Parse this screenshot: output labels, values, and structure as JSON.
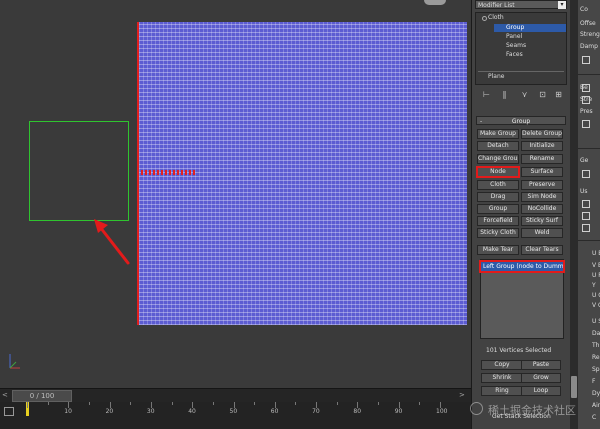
{
  "timeline": {
    "frame_counter": "0 / 100",
    "ruler_labels": [
      "10",
      "20",
      "30",
      "40",
      "50",
      "60",
      "70",
      "80",
      "90",
      "100"
    ]
  },
  "modifier_panel": {
    "modifier_list_label": "Modifier List",
    "stack": {
      "cloth": "Cloth",
      "group": "Group",
      "panel": "Panel",
      "seams": "Seams",
      "faces": "Faces",
      "plane": "Plane"
    },
    "rollout_title": "Group",
    "buttons": {
      "make_group": "Make Group",
      "delete_group": "Delete Group",
      "detach": "Detach",
      "initialize": "Initialize",
      "change_group": "Change Group",
      "rename": "Rename",
      "node": "Node",
      "surface": "Surface",
      "cloth": "Cloth",
      "preserve": "Preserve",
      "drag": "Drag",
      "sim_node": "Sim Node",
      "group": "Group",
      "nocollide": "NoCollide",
      "forcefield": "Forcefield",
      "sticky_surf": "Sticky Surf",
      "sticky_cloth": "Sticky Cloth",
      "weld": "Weld",
      "make_tear": "Make Tear",
      "clear_tears": "Clear Tears",
      "copy": "Copy",
      "paste": "Paste",
      "shrink": "Shrink",
      "grow": "Grow",
      "ring": "Ring",
      "loop": "Loop"
    },
    "group_list_item": "Left Group (node to Dummy",
    "vertices_selected": "101 Vertices Selected",
    "get_stack_selection": "Get Stack Selection"
  },
  "right_panel": {
    "items": [
      "Co",
      "Offse",
      "Streng",
      "Damp",
      "Be",
      "Stre",
      "Pres",
      "Ge",
      "Us",
      "U Bi",
      "V Bi",
      "U Re",
      "Y",
      "U Cc",
      "V Cc",
      "U Sc",
      "Dam",
      "Thi",
      "Re",
      "Sp",
      "F",
      "Dyna",
      "Air",
      "C"
    ]
  },
  "watermark": "稀土掘金技术社区",
  "colors": {
    "mesh": "#5c5cd2",
    "selection_red": "#e21b1b",
    "stack_highlight": "#2d5aa8",
    "shape_green": "#2fc42f"
  }
}
